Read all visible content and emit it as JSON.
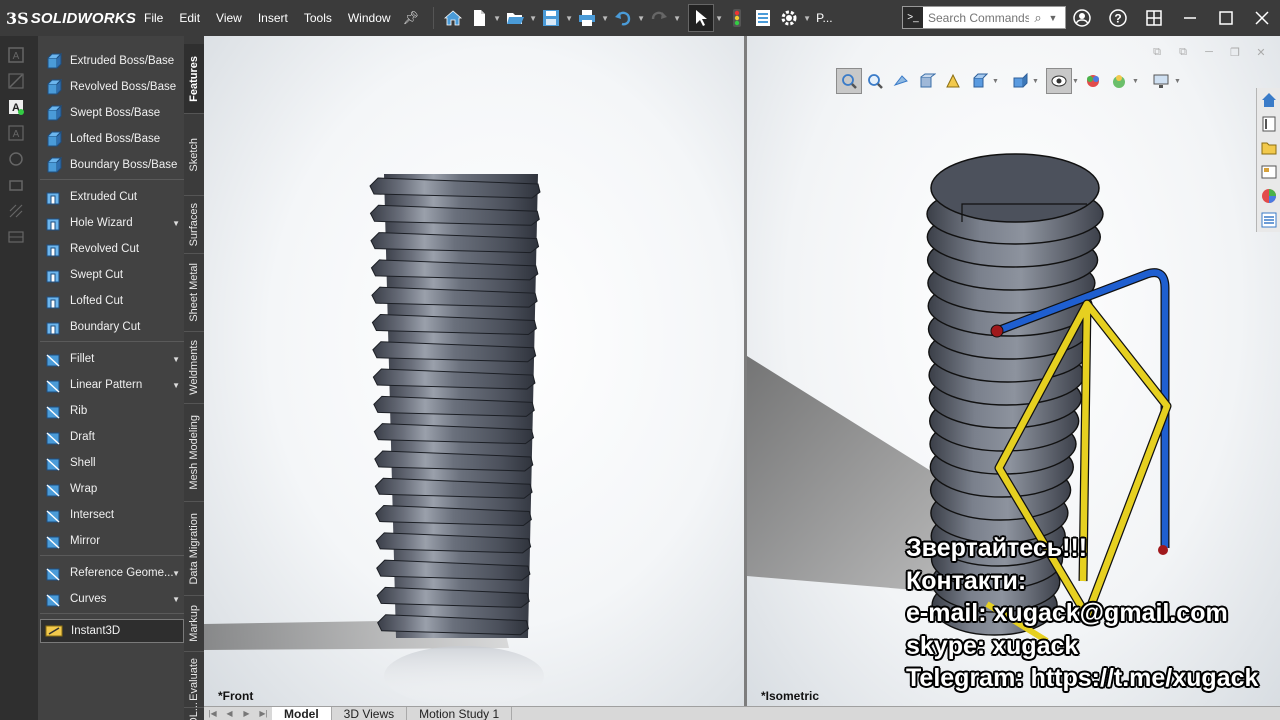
{
  "app": {
    "name": "SOLIDWORKS",
    "logo_prefix": "3S"
  },
  "menu": [
    "File",
    "Edit",
    "View",
    "Insert",
    "Tools",
    "Window"
  ],
  "toolbar": {
    "options_label": "P..."
  },
  "search": {
    "placeholder": "Search Commands"
  },
  "commands": [
    {
      "label": "Extruded Boss/Base",
      "icon": "extruded-boss-icon"
    },
    {
      "label": "Revolved Boss/Base",
      "icon": "revolved-boss-icon"
    },
    {
      "label": "Swept Boss/Base",
      "icon": "swept-boss-icon"
    },
    {
      "label": "Lofted Boss/Base",
      "icon": "lofted-boss-icon"
    },
    {
      "label": "Boundary Boss/Base",
      "icon": "boundary-boss-icon"
    },
    {
      "label": "Extruded Cut",
      "icon": "extruded-cut-icon"
    },
    {
      "label": "Hole Wizard",
      "icon": "hole-wizard-icon",
      "dropdown": true
    },
    {
      "label": "Revolved Cut",
      "icon": "revolved-cut-icon"
    },
    {
      "label": "Swept Cut",
      "icon": "swept-cut-icon"
    },
    {
      "label": "Lofted Cut",
      "icon": "lofted-cut-icon"
    },
    {
      "label": "Boundary Cut",
      "icon": "boundary-cut-icon"
    },
    {
      "label": "Fillet",
      "icon": "fillet-icon",
      "dropdown": true
    },
    {
      "label": "Linear Pattern",
      "icon": "linear-pattern-icon",
      "dropdown": true
    },
    {
      "label": "Rib",
      "icon": "rib-icon"
    },
    {
      "label": "Draft",
      "icon": "draft-icon"
    },
    {
      "label": "Shell",
      "icon": "shell-icon"
    },
    {
      "label": "Wrap",
      "icon": "wrap-icon"
    },
    {
      "label": "Intersect",
      "icon": "intersect-icon"
    },
    {
      "label": "Mirror",
      "icon": "mirror-icon"
    },
    {
      "label": "Reference Geome...",
      "icon": "reference-geometry-icon",
      "dropdown": true
    },
    {
      "label": "Curves",
      "icon": "curves-icon",
      "dropdown": true
    },
    {
      "label": "Instant3D",
      "icon": "instant3d-icon",
      "active": true
    }
  ],
  "vertical_tabs": [
    "Features",
    "Sketch",
    "Surfaces",
    "Sheet Metal",
    "Weldments",
    "Mesh Modeling",
    "Data Migration",
    "Markup",
    "Evaluate",
    "SOL..."
  ],
  "viewports": {
    "front_label": "*Front",
    "iso_label": "*Isometric"
  },
  "contact_lines": [
    "Звертайтесь!!!",
    "Контакти:",
    "e-mail: xugack@gmail.com",
    "skype: xugack",
    "Telegram: https://t.me/xugack"
  ],
  "bottom_tabs": [
    "Model",
    "3D Views",
    "Motion Study 1"
  ],
  "colors": {
    "dark_bg": "#3b3b3b",
    "panel_bg": "#424242",
    "icon_blue": "#4a9bd8",
    "part_gray": "#5f6470",
    "handle_blue": "#1f5fd0",
    "handle_yellow": "#e6d020"
  }
}
